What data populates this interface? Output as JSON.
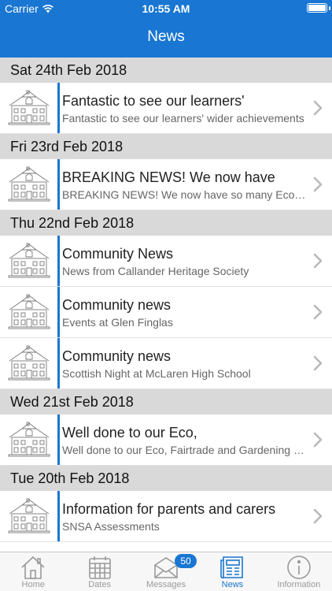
{
  "status_bar": {
    "carrier": "Carrier",
    "time": "10:55 AM"
  },
  "header": {
    "title": "News"
  },
  "sections": [
    {
      "date": "Sat 24th Feb 2018",
      "items": [
        {
          "title": "Fantastic to see our learners'",
          "subtitle": "Fantastic to see our learners' wider achievements"
        }
      ]
    },
    {
      "date": "Fri 23rd Feb 2018",
      "items": [
        {
          "title": "BREAKING NEWS! We now have",
          "subtitle": "BREAKING NEWS! We now have so many Eco flags"
        }
      ]
    },
    {
      "date": "Thu 22nd Feb 2018",
      "items": [
        {
          "title": "Community  News",
          "subtitle": "News from Callander Heritage Society"
        },
        {
          "title": "Community news",
          "subtitle": "Events at Glen Finglas"
        },
        {
          "title": "Community news",
          "subtitle": "Scottish Night at McLaren High School"
        }
      ]
    },
    {
      "date": "Wed 21st Feb 2018",
      "items": [
        {
          "title": "Well done to our Eco,",
          "subtitle": "Well done to our Eco, Fairtrade and Gardening group"
        }
      ]
    },
    {
      "date": "Tue 20th Feb 2018",
      "items": [
        {
          "title": "Information for parents and carers",
          "subtitle": "SNSA Assessments"
        }
      ]
    }
  ],
  "tabbar": {
    "tabs": [
      {
        "label": "Home",
        "icon": "home-icon"
      },
      {
        "label": "Dates",
        "icon": "calendar-icon"
      },
      {
        "label": "Messages",
        "icon": "envelope-icon"
      },
      {
        "label": "News",
        "icon": "newspaper-icon",
        "active": true
      },
      {
        "label": "Information",
        "icon": "info-icon"
      }
    ],
    "messages_badge": "50"
  },
  "colors": {
    "accent": "#1976d2",
    "section_bg": "#d9d9d9",
    "tab_inactive": "#9a9a9a"
  }
}
